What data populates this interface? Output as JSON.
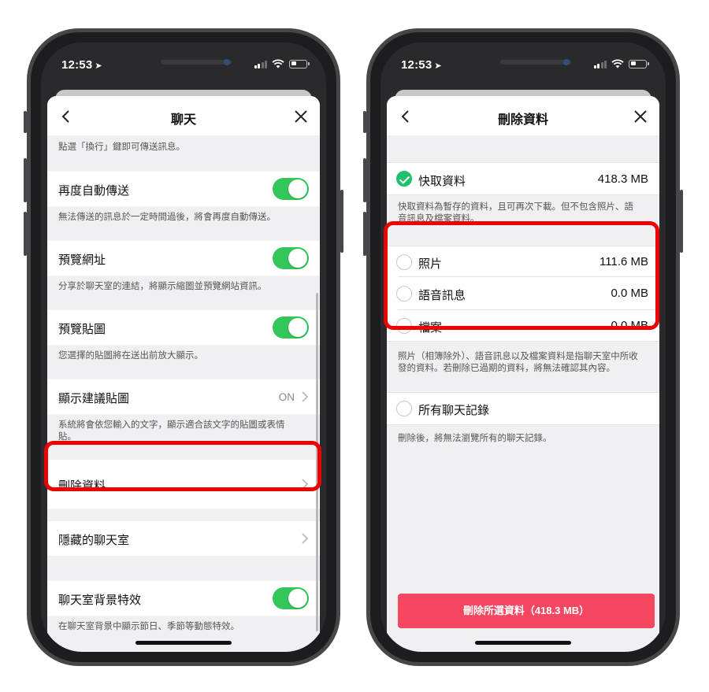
{
  "status": {
    "time": "12:53",
    "location_icon": "location-arrow-icon"
  },
  "left": {
    "title": "聊天",
    "top_note": "點選「換行」鍵即可傳送訊息。",
    "resend": {
      "label": "再度自動傳送",
      "desc": "無法傳送的訊息於一定時間過後，將會再度自動傳送。",
      "on": true
    },
    "preview_url": {
      "label": "預覽網址",
      "desc": "分享於聊天室的連結，將顯示縮圖並預覽網站資訊。",
      "on": true
    },
    "preview_sticker": {
      "label": "預覽貼圖",
      "desc": "您選擇的貼圖將在送出前放大顯示。",
      "on": true
    },
    "suggest_sticker": {
      "label": "顯示建議貼圖",
      "value": "ON",
      "desc": "系統將會依您輸入的文字，顯示適合該文字的貼圖或表情貼。"
    },
    "delete_data": {
      "label": "刪除資料"
    },
    "hidden_chats": {
      "label": "隱藏的聊天室"
    },
    "bg_effect": {
      "label": "聊天室背景特效",
      "desc": "在聊天室背景中顯示節日、季節等動態特效。",
      "on": true
    }
  },
  "right": {
    "title": "刪除資料",
    "cache": {
      "label": "快取資料",
      "size": "418.3 MB",
      "checked": true,
      "desc": "快取資料為暫存的資料，且可再次下載。但不包含照片、語音訊息及檔案資料。"
    },
    "options": [
      {
        "label": "照片",
        "size": "111.6 MB",
        "checked": false
      },
      {
        "label": "語音訊息",
        "size": "0.0 MB",
        "checked": false
      },
      {
        "label": "檔案",
        "size": "0.0 MB",
        "checked": false
      }
    ],
    "options_desc": "照片（相簿除外）、語音訊息以及檔案資料是指聊天室中所收發的資料。若刪除已過期的資料，將無法確認其內容。",
    "all_chats": {
      "label": "所有聊天記錄",
      "checked": false,
      "desc": "刪除後，將無法瀏覽所有的聊天記錄。"
    },
    "delete_button": "刪除所選資料（418.3 MB）"
  },
  "colors": {
    "toggle_on": "#34c759",
    "check_green": "#1fc26a",
    "delete_red": "#f74760",
    "highlight": "#ee0000"
  }
}
